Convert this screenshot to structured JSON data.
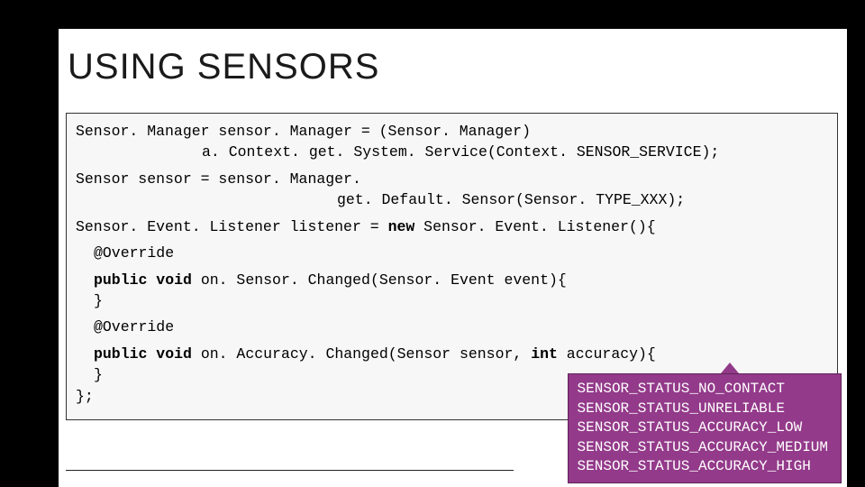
{
  "title": "USING SENSORS",
  "code": {
    "l1": "Sensor. Manager sensor. Manager = (Sensor. Manager)",
    "l2": "a. Context. get. System. Service(Context. SENSOR_SERVICE);",
    "l3": "Sensor sensor = sensor. Manager.",
    "l4": "get. Default. Sensor(Sensor. TYPE_XXX);",
    "l5a": "Sensor. Event. Listener listener = ",
    "l5new": "new",
    "l5b": " Sensor. Event. Listener(){",
    "l6": "@Override",
    "l7a": "public void",
    "l7b": " on. Sensor. Changed(Sensor. Event event){",
    "l8": "}",
    "l9": "@Override",
    "l10a": "public void",
    "l10b": " on. Accuracy. Changed(Sensor sensor, ",
    "l10int": "int",
    "l10c": " accuracy){",
    "l11": "}",
    "l12": "};"
  },
  "callout": {
    "c1": "SENSOR_STATUS_NO_CONTACT",
    "c2": "SENSOR_STATUS_UNRELIABLE",
    "c3": "SENSOR_STATUS_ACCURACY_LOW",
    "c4": "SENSOR_STATUS_ACCURACY_MEDIUM",
    "c5": "SENSOR_STATUS_ACCURACY_HIGH"
  }
}
